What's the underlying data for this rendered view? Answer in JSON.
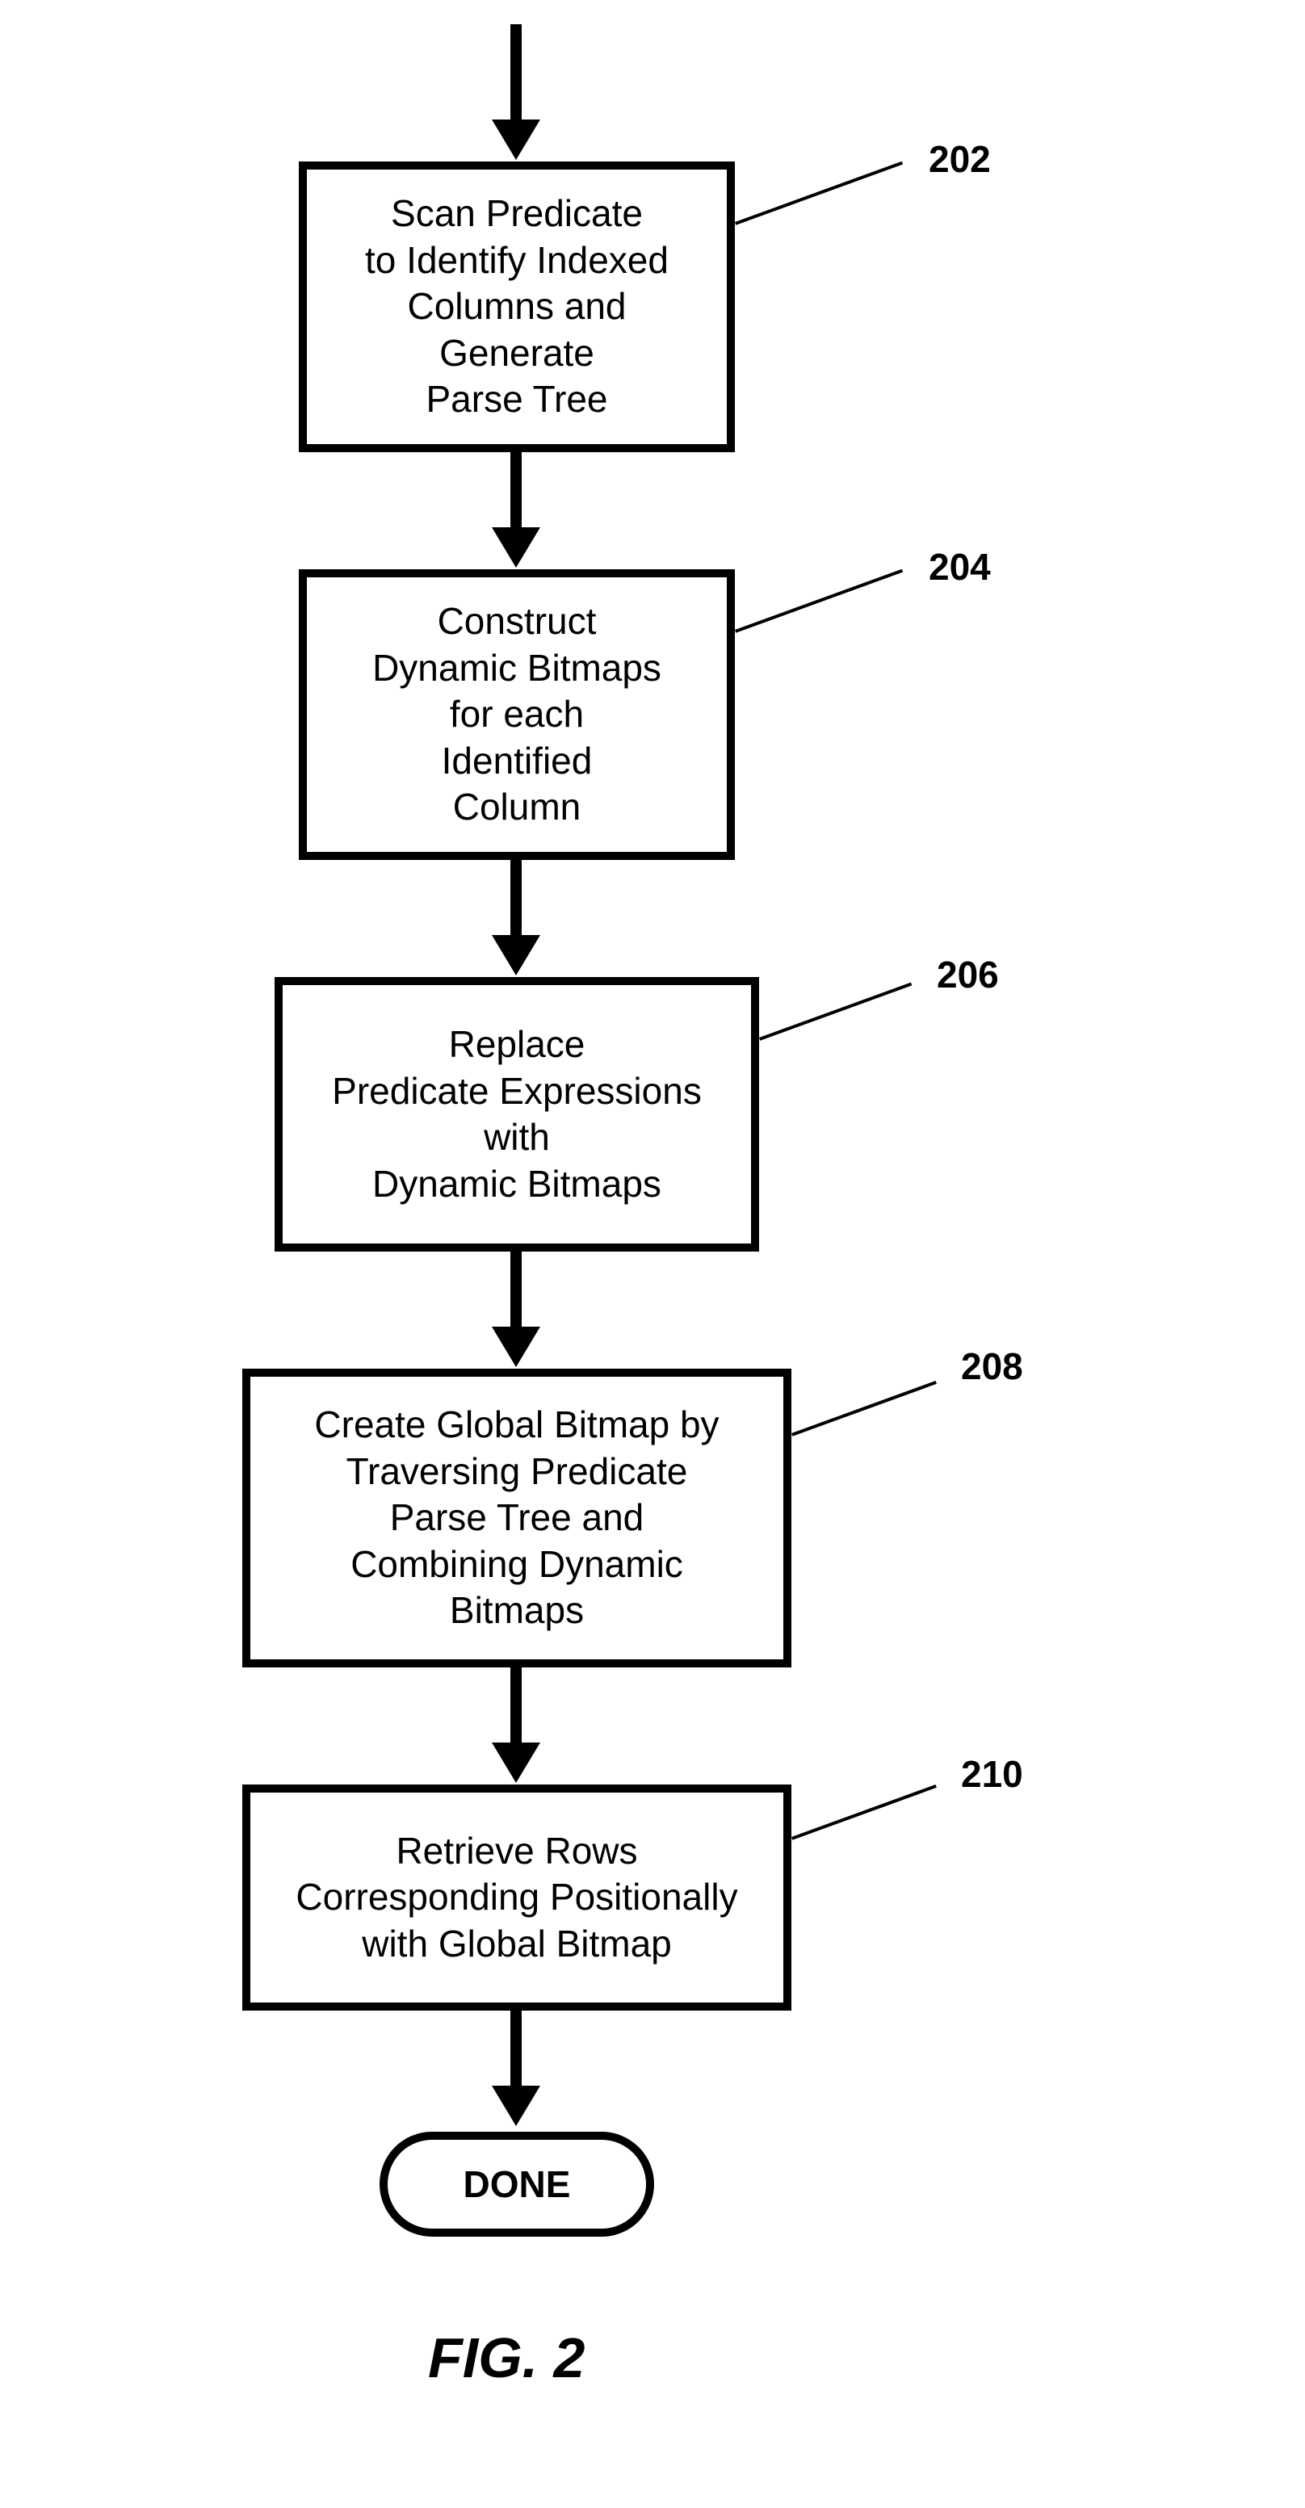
{
  "flow": {
    "steps": [
      {
        "id": "202",
        "text": "Scan Predicate\nto Identify Indexed\nColumns and\nGenerate\nParse Tree"
      },
      {
        "id": "204",
        "text": "Construct\nDynamic Bitmaps\nfor each\nIdentified\nColumn"
      },
      {
        "id": "206",
        "text": "Replace\nPredicate Expressions\nwith\nDynamic Bitmaps"
      },
      {
        "id": "208",
        "text": "Create Global Bitmap by\nTraversing Predicate\nParse Tree  and\nCombining Dynamic\nBitmaps"
      },
      {
        "id": "210",
        "text": "Retrieve Rows\nCorresponding Positionally\nwith Global Bitmap"
      }
    ],
    "terminal": "DONE",
    "figure_label": "FIG. 2"
  }
}
